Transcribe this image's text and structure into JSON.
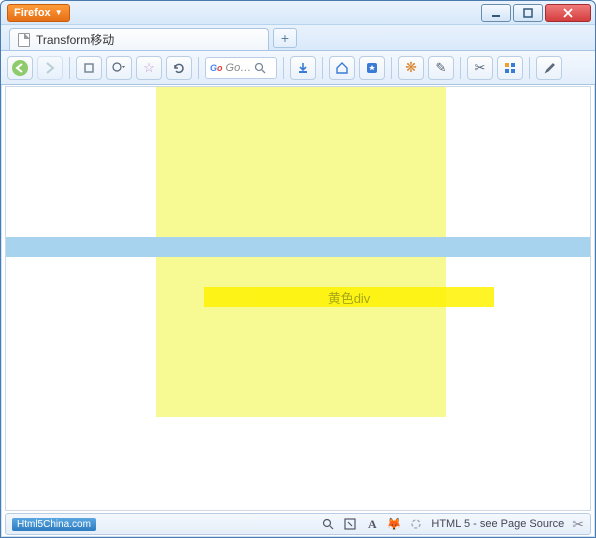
{
  "titlebar": {
    "firefox_label": "Firefox"
  },
  "tabs": {
    "active_title": "Transform移动",
    "newtab_symbol": "+"
  },
  "toolbar": {
    "search_placeholder": "Go…"
  },
  "content": {
    "yellow_div_label": "黄色div"
  },
  "statusbar": {
    "badge": "Html5China.com",
    "font_letter": "A",
    "message": "HTML 5 - see Page Source"
  }
}
